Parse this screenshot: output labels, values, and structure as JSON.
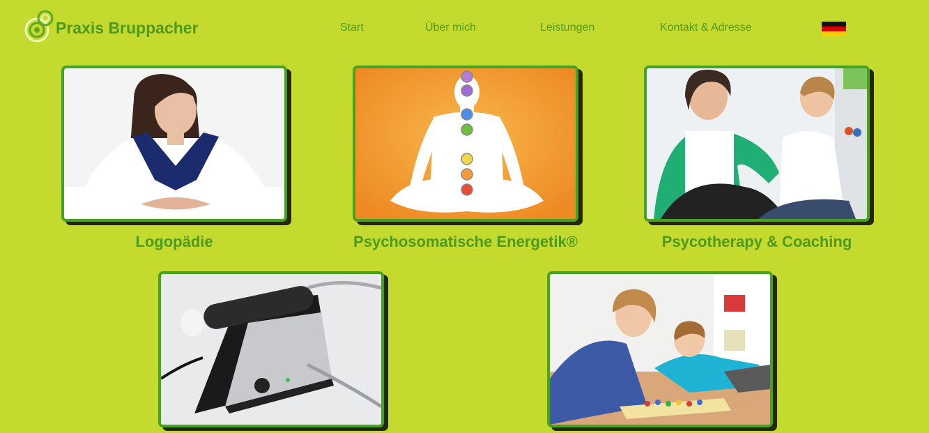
{
  "brand": {
    "name": "Praxis Bruppacher"
  },
  "nav": {
    "start": "Start",
    "about": "Über mich",
    "services": "Leistungen",
    "contact": "Kontakt & Adresse"
  },
  "language": {
    "flag": "german-flag-icon"
  },
  "services": [
    {
      "title": "Logopädie"
    },
    {
      "title": "Psychosomatische Energetik®"
    },
    {
      "title": "Psycotherapy & Coaching"
    },
    {
      "title": ""
    },
    {
      "title": ""
    }
  ],
  "colors": {
    "background": "#c5da2f",
    "accent": "#4d9a1f",
    "frame": "#45a31e"
  }
}
